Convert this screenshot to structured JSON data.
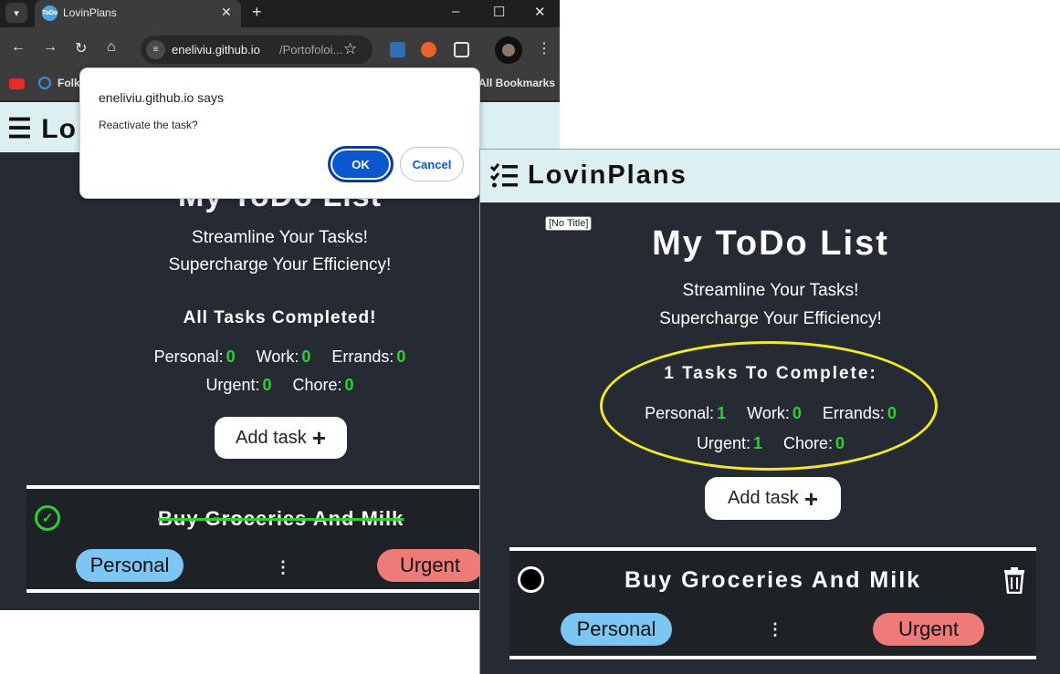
{
  "browser": {
    "tab_title": "LovinPlans",
    "tab_favicon_text": "ToDo",
    "url_host": "eneliviu.github.io",
    "url_path": "/Portofoloi...",
    "bookmarks": {
      "item1": "Folk",
      "all_bookmarks": "All Bookmarks"
    }
  },
  "dialog": {
    "title": "eneliviu.github.io says",
    "message": "Reactivate the task?",
    "ok_label": "OK",
    "cancel_label": "Cancel"
  },
  "left_app": {
    "nav_logo": "Lo",
    "title": "My ToDo List",
    "tagline1": "Streamline Your Tasks!",
    "tagline2": "Supercharge Your Efficiency!",
    "status": "All Tasks Completed!",
    "counts": {
      "personal_label": "Personal:",
      "personal": "0",
      "work_label": "Work:",
      "work": "0",
      "errands_label": "Errands:",
      "errands": "0",
      "urgent_label": "Urgent:",
      "urgent": "0",
      "chore_label": "Chore:",
      "chore": "0"
    },
    "add_task_label": "Add task",
    "task": {
      "name": "Buy Groceries And Milk",
      "category": "Personal",
      "priority": "Urgent",
      "completed": true
    }
  },
  "right_app": {
    "logo_text": "LovinPlans",
    "tooltip": "[No Title]",
    "title": "My ToDo List",
    "tagline1": "Streamline Your Tasks!",
    "tagline2": "Supercharge Your Efficiency!",
    "status": "1 Tasks To Complete:",
    "counts": {
      "personal_label": "Personal:",
      "personal": "1",
      "work_label": "Work:",
      "work": "0",
      "errands_label": "Errands:",
      "errands": "0",
      "urgent_label": "Urgent:",
      "urgent": "1",
      "chore_label": "Chore:",
      "chore": "0"
    },
    "add_task_label": "Add task",
    "task": {
      "name": "Buy Groceries And Milk",
      "category": "Personal",
      "priority": "Urgent",
      "completed": false
    }
  },
  "colors": {
    "page_bg": "#262a33",
    "nav_bg": "#dcf0f1",
    "count_green": "#2ad130",
    "personal_pill": "#7cc6f4",
    "urgent_pill": "#ee7b78",
    "highlight_ellipse": "#f2ea1e",
    "dialog_ok": "#0b57d0"
  },
  "icons": {
    "logo": "checklist-icon",
    "add": "plus-icon",
    "done": "check-circle-icon",
    "pending": "circle-icon",
    "delete": "trash-icon",
    "menu": "vertical-dots-icon"
  }
}
